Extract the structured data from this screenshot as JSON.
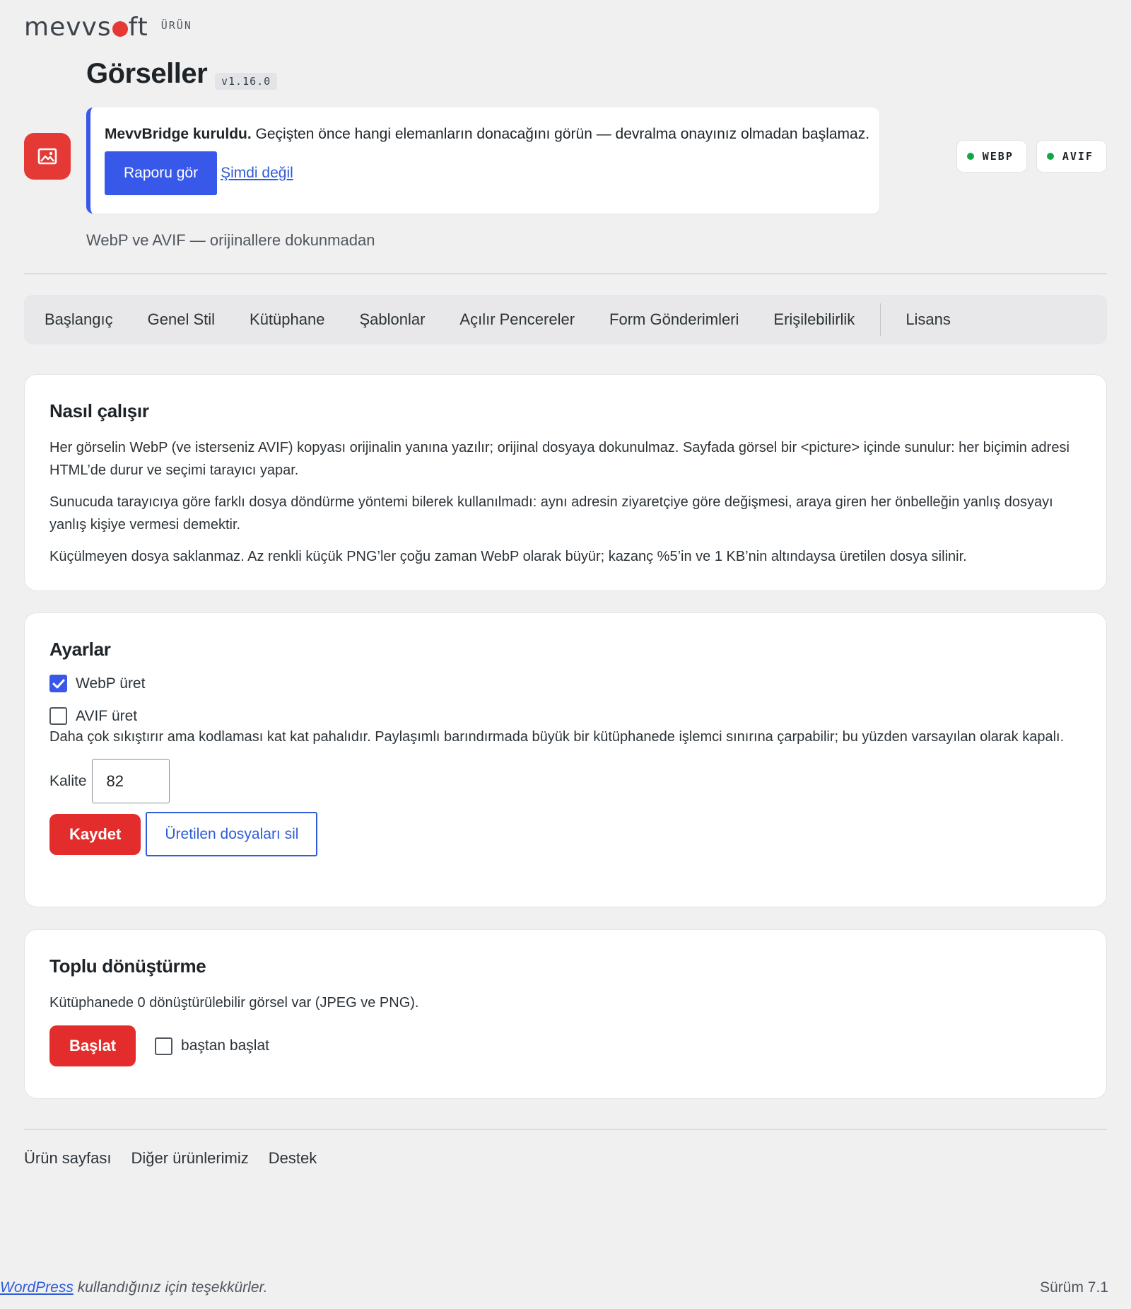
{
  "brand": {
    "logo_pre": "mevvs",
    "logo_post": "ft",
    "tag": "ÜRÜN"
  },
  "header": {
    "title": "Görseller",
    "version": "v1.16.0",
    "subtitle": "WebP ve AVIF — orijinallere dokunmadan"
  },
  "notice": {
    "title": "MevvBridge kuruldu.",
    "text": "Geçişten önce hangi elemanların donacağını görün — devralma onayınız olmadan başlamaz.",
    "primary_label": "Raporu gör",
    "secondary_label": "Şimdi değil"
  },
  "format_badges": [
    {
      "label": "WEBP",
      "status_color": "#16a34a"
    },
    {
      "label": "AVIF",
      "status_color": "#16a34a"
    }
  ],
  "tabs": [
    "Başlangıç",
    "Genel Stil",
    "Kütüphane",
    "Şablonlar",
    "Açılır Pencereler",
    "Form Gönderimleri",
    "Erişilebilirlik",
    "Lisans"
  ],
  "how": {
    "title": "Nasıl çalışır",
    "p1": "Her görselin WebP (ve isterseniz AVIF) kopyası orijinalin yanına yazılır; orijinal dosyaya dokunulmaz. Sayfada görsel bir <picture> içinde sunulur: her biçimin adresi HTML’de durur ve seçimi tarayıcı yapar.",
    "p2": "Sunucuda tarayıcıya göre farklı dosya döndürme yöntemi bilerek kullanılmadı: aynı adresin ziyaretçiye göre değişmesi, araya giren her önbelleğin yanlış dosyayı yanlış kişiye vermesi demektir.",
    "p3": "Küçülmeyen dosya saklanmaz. Az renkli küçük PNG’ler çoğu zaman WebP olarak büyür; kazanç %5’in ve 1 KB’nin altındaysa üretilen dosya silinir."
  },
  "settings": {
    "title": "Ayarlar",
    "webp_label": "WebP üret",
    "webp_checked": true,
    "avif_label": "AVIF üret",
    "avif_checked": false,
    "avif_help": "Daha çok sıkıştırır ama kodlaması kat kat pahalıdır. Paylaşımlı barındırmada büyük bir kütüphanede işlemci sınırına çarpabilir; bu yüzden varsayılan olarak kapalı.",
    "quality_label": "Kalite",
    "quality_value": "82",
    "save_label": "Kaydet",
    "delete_label": "Üretilen dosyaları sil"
  },
  "bulk": {
    "title": "Toplu dönüştürme",
    "text": "Kütüphanede 0 dönüştürülebilir görsel var (JPEG ve PNG).",
    "start_label": "Başlat",
    "restart_label": "baştan başlat",
    "restart_checked": false
  },
  "footer_links": [
    "Ürün sayfası",
    "Diğer ürünlerimiz",
    "Destek"
  ],
  "wp_footer": {
    "link": "WordPress",
    "text": " kullandığınız için teşekkürler.",
    "version": "Sürüm 7.1"
  },
  "colors": {
    "accent_red": "#e32d2d",
    "accent_blue": "#3858e9",
    "status_green": "#16a34a"
  }
}
